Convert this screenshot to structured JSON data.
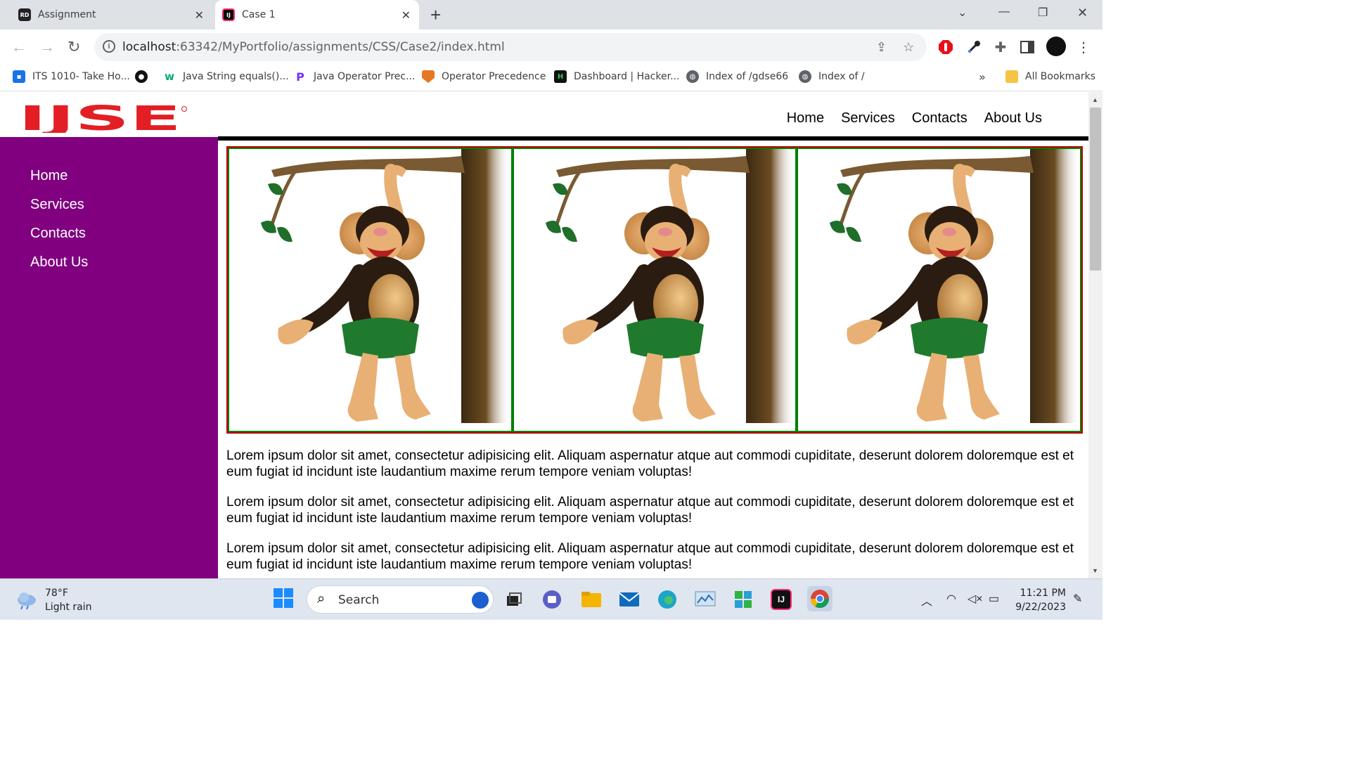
{
  "browser": {
    "tabs": [
      {
        "title": "Assignment",
        "favicon": "RD",
        "active": false
      },
      {
        "title": "Case 1",
        "favicon": "IJ",
        "active": true
      }
    ],
    "url_host": "localhost",
    "url_path": ":63342/MyPortfolio/assignments/CSS/Case2/index.html",
    "bookmarks": [
      "ITS 1010- Take Ho...",
      "",
      "Java String equals()...",
      "Java Operator Prec...",
      "Operator Precedence",
      "Dashboard | Hacker...",
      "Index of /gdse66",
      "Index of /"
    ],
    "bookmarks_overflow": "»",
    "all_bookmarks": "All Bookmarks"
  },
  "page": {
    "logo_text": "IJSE",
    "top_nav": [
      "Home",
      "Services",
      "Contacts",
      "About Us"
    ],
    "side_nav": [
      "Home",
      "Services",
      "Contacts",
      "About Us"
    ],
    "paragraphs": [
      "Lorem ipsum dolor sit amet, consectetur adipisicing elit. Aliquam aspernatur atque aut commodi cupiditate, deserunt dolorem doloremque est et eum fugiat id incidunt iste laudantium maxime rerum tempore veniam voluptas!",
      "Lorem ipsum dolor sit amet, consectetur adipisicing elit. Aliquam aspernatur atque aut commodi cupiditate, deserunt dolorem doloremque est et eum fugiat id incidunt iste laudantium maxime rerum tempore veniam voluptas!",
      "Lorem ipsum dolor sit amet, consectetur adipisicing elit. Aliquam aspernatur atque aut commodi cupiditate, deserunt dolorem doloremque est et eum fugiat id incidunt iste laudantium maxime rerum tempore veniam voluptas!"
    ],
    "colors": {
      "sidebar": "#800080",
      "logo": "#e31e24",
      "gallery_border": "#c00000",
      "cell_border": "#008000"
    }
  },
  "taskbar": {
    "temperature": "78°F",
    "weather": "Light rain",
    "search_label": "Search",
    "time": "11:21 PM",
    "date": "9/22/2023"
  }
}
